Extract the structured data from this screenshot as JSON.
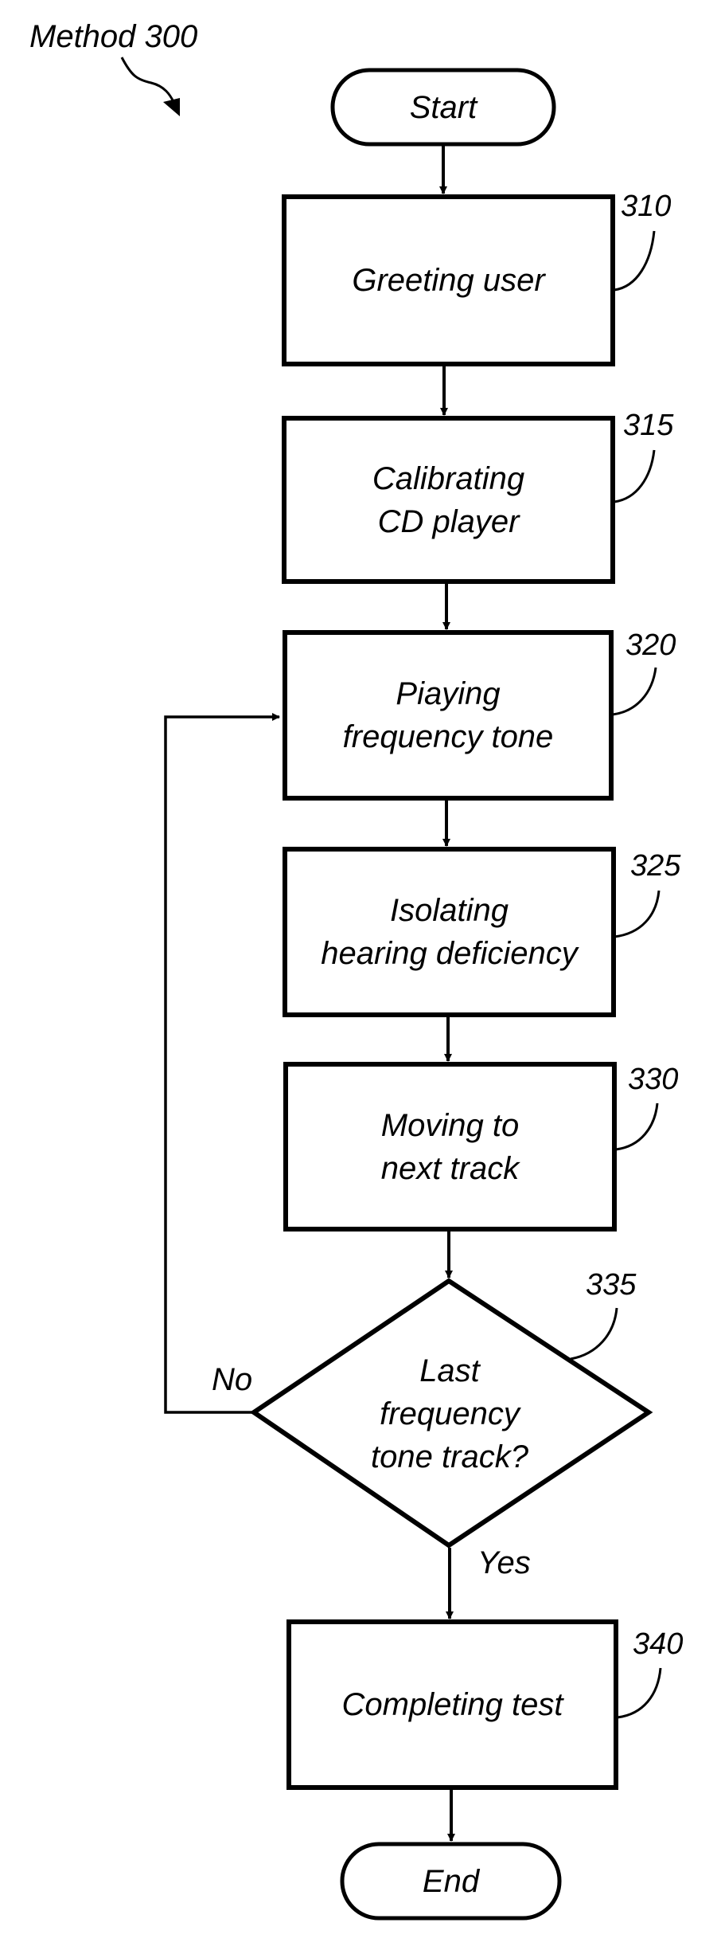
{
  "figure": {
    "title": "Method 300",
    "stroke_color": "#000000",
    "background_color": "#ffffff"
  },
  "nodes": [
    {
      "id": "start",
      "type": "terminal",
      "lines": [
        "Start"
      ]
    },
    {
      "id": "310",
      "type": "process",
      "ref": "310",
      "lines": [
        "Greeting user"
      ]
    },
    {
      "id": "315",
      "type": "process",
      "ref": "315",
      "lines": [
        "Calibrating",
        "CD player"
      ]
    },
    {
      "id": "320",
      "type": "process",
      "ref": "320",
      "lines": [
        "Piaying",
        "frequency tone"
      ]
    },
    {
      "id": "325",
      "type": "process",
      "ref": "325",
      "lines": [
        "Isolating",
        "hearing deficiency"
      ]
    },
    {
      "id": "330",
      "type": "process",
      "ref": "330",
      "lines": [
        "Moving to",
        "next track"
      ]
    },
    {
      "id": "335",
      "type": "decision",
      "ref": "335",
      "lines": [
        "Last",
        "frequency",
        "tone track?"
      ]
    },
    {
      "id": "340",
      "type": "process",
      "ref": "340",
      "lines": [
        "Completing test"
      ]
    },
    {
      "id": "end",
      "type": "terminal",
      "lines": [
        "End"
      ]
    }
  ],
  "edges": [
    {
      "from": "start",
      "to": "310"
    },
    {
      "from": "310",
      "to": "315"
    },
    {
      "from": "315",
      "to": "320"
    },
    {
      "from": "320",
      "to": "325"
    },
    {
      "from": "325",
      "to": "330"
    },
    {
      "from": "330",
      "to": "335"
    },
    {
      "from": "335",
      "to": "320",
      "label": "No"
    },
    {
      "from": "335",
      "to": "340",
      "label": "Yes"
    },
    {
      "from": "340",
      "to": "end"
    }
  ],
  "branch_labels": {
    "no": "No",
    "yes": "Yes"
  }
}
